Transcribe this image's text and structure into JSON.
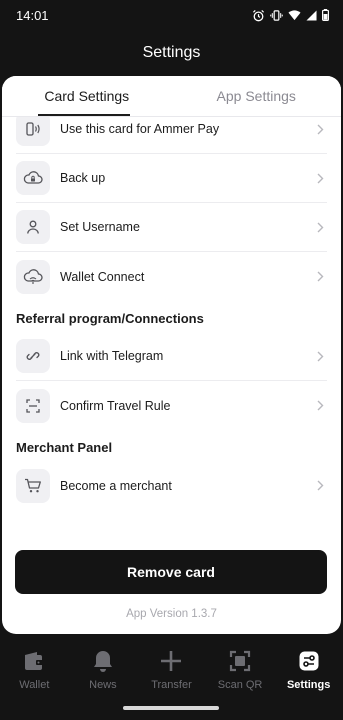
{
  "status": {
    "time": "14:01"
  },
  "header": {
    "title": "Settings"
  },
  "tabs": [
    {
      "label": "Card Settings"
    },
    {
      "label": "App Settings"
    }
  ],
  "rows_top": [
    {
      "label": "Use this card for Ammer Pay",
      "icon": "nfc-card-icon"
    },
    {
      "label": "Back up",
      "icon": "cloud-lock-icon"
    },
    {
      "label": "Set Username",
      "icon": "user-icon"
    },
    {
      "label": "Wallet Connect",
      "icon": "cloud-wifi-icon"
    }
  ],
  "referral": {
    "title": "Referral program/Connections",
    "items": [
      {
        "label": "Link with Telegram",
        "icon": "link-icon"
      },
      {
        "label": "Confirm Travel Rule",
        "icon": "scan-frame-icon"
      }
    ]
  },
  "merchant": {
    "title": "Merchant Panel",
    "items": [
      {
        "label": "Become a merchant",
        "icon": "cart-icon"
      }
    ]
  },
  "remove_button": "Remove card",
  "version": "App Version 1.3.7",
  "nav": [
    {
      "label": "Wallet",
      "icon": "wallet-icon",
      "active": false
    },
    {
      "label": "News",
      "icon": "bell-icon",
      "active": false
    },
    {
      "label": "Transfer",
      "icon": "plus-icon",
      "active": false
    },
    {
      "label": "Scan QR",
      "icon": "scan-qr-icon",
      "active": false
    },
    {
      "label": "Settings",
      "icon": "settings-toggle-icon",
      "active": true
    }
  ],
  "colors": {
    "background": "#141414",
    "sheet": "#ffffff",
    "icon_bg": "#f0f0f3",
    "muted": "#8b8a92"
  }
}
